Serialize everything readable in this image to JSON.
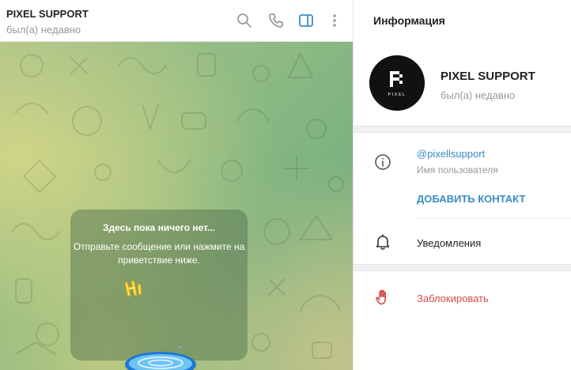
{
  "chat": {
    "title": "PIXEL SUPPORT",
    "status": "был(а) недавно",
    "empty_title": "Здесь пока ничего нет...",
    "empty_text": "Отправьте сообщение или нажмите на приветствие ниже."
  },
  "header_icons": [
    "search-icon",
    "phone-icon",
    "sidebar-toggle-icon",
    "more-vertical-icon"
  ],
  "info": {
    "header": "Информация",
    "avatar_text": "PIXEL",
    "name": "PIXEL SUPPORT",
    "status": "был(а) недавно",
    "username": "@pixellsupport",
    "username_caption": "Имя пользователя",
    "add_contact": "ДОБАВИТЬ КОНТАКТ",
    "notifications": "Уведомления",
    "block": "Заблокировать"
  },
  "colors": {
    "accent": "#3a8cc4",
    "danger": "#d14b4b",
    "muted": "#999999"
  }
}
